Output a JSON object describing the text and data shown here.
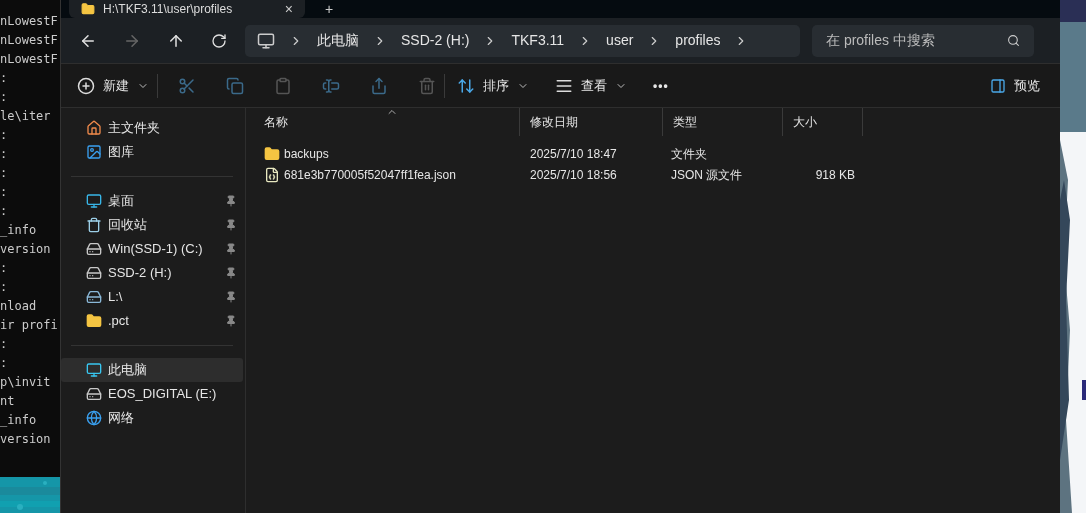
{
  "terminal": {
    "lines": [
      "nLowestF",
      "nLowestF",
      "nLowestF",
      ":",
      ":",
      "le\\iter",
      ":",
      ":",
      ":",
      ":",
      ":",
      "_info",
      "version",
      ":",
      ":",
      "nload",
      "ir profi",
      ":",
      ":",
      "p\\invit",
      "nt",
      "_info",
      "version"
    ]
  },
  "tab": {
    "title": "H:\\TKF3.11\\user\\profiles",
    "close": "×",
    "new": "+"
  },
  "nav": {
    "back_disabled": false,
    "forward_disabled": true
  },
  "breadcrumb": [
    "此电脑",
    "SSD-2 (H:)",
    "TKF3.11",
    "user",
    "profiles"
  ],
  "search": {
    "placeholder": "在 profiles 中搜索"
  },
  "toolbar": {
    "new": "新建",
    "sort": "排序",
    "view": "查看",
    "more": "•••",
    "preview": "预览"
  },
  "sidebar": {
    "groups": [
      [
        {
          "label": "主文件夹",
          "kind": "home",
          "pinned": false,
          "selected": false
        },
        {
          "label": "图库",
          "kind": "gallery",
          "pinned": false,
          "selected": false
        }
      ],
      [
        {
          "label": "桌面",
          "kind": "desktop",
          "pinned": true,
          "selected": false
        },
        {
          "label": "回收站",
          "kind": "recycle",
          "pinned": true,
          "selected": false
        },
        {
          "label": "Win(SSD-1) (C:)",
          "kind": "drive",
          "pinned": true,
          "selected": false
        },
        {
          "label": "SSD-2 (H:)",
          "kind": "drive",
          "pinned": true,
          "selected": false
        },
        {
          "label": "L:\\",
          "kind": "netdrive",
          "pinned": true,
          "selected": false
        },
        {
          "label": ".pct",
          "kind": "folder",
          "pinned": true,
          "selected": false
        }
      ],
      [
        {
          "label": "此电脑",
          "kind": "pc",
          "pinned": false,
          "selected": true
        },
        {
          "label": "EOS_DIGITAL (E:)",
          "kind": "drive",
          "pinned": false,
          "selected": false
        },
        {
          "label": "网络",
          "kind": "network",
          "pinned": false,
          "selected": false
        }
      ]
    ]
  },
  "table": {
    "columns": [
      "名称",
      "修改日期",
      "类型",
      "大小"
    ],
    "rows": [
      {
        "kind": "folder",
        "name": "backups",
        "date": "2025/7/10 18:47",
        "type": "文件夹"
      },
      {
        "kind": "file",
        "name": "681e3b770005f52047ff1fea.json",
        "date": "2025/7/10 18:56",
        "type": "JSON 源文件",
        "size": "918 KB"
      }
    ]
  }
}
